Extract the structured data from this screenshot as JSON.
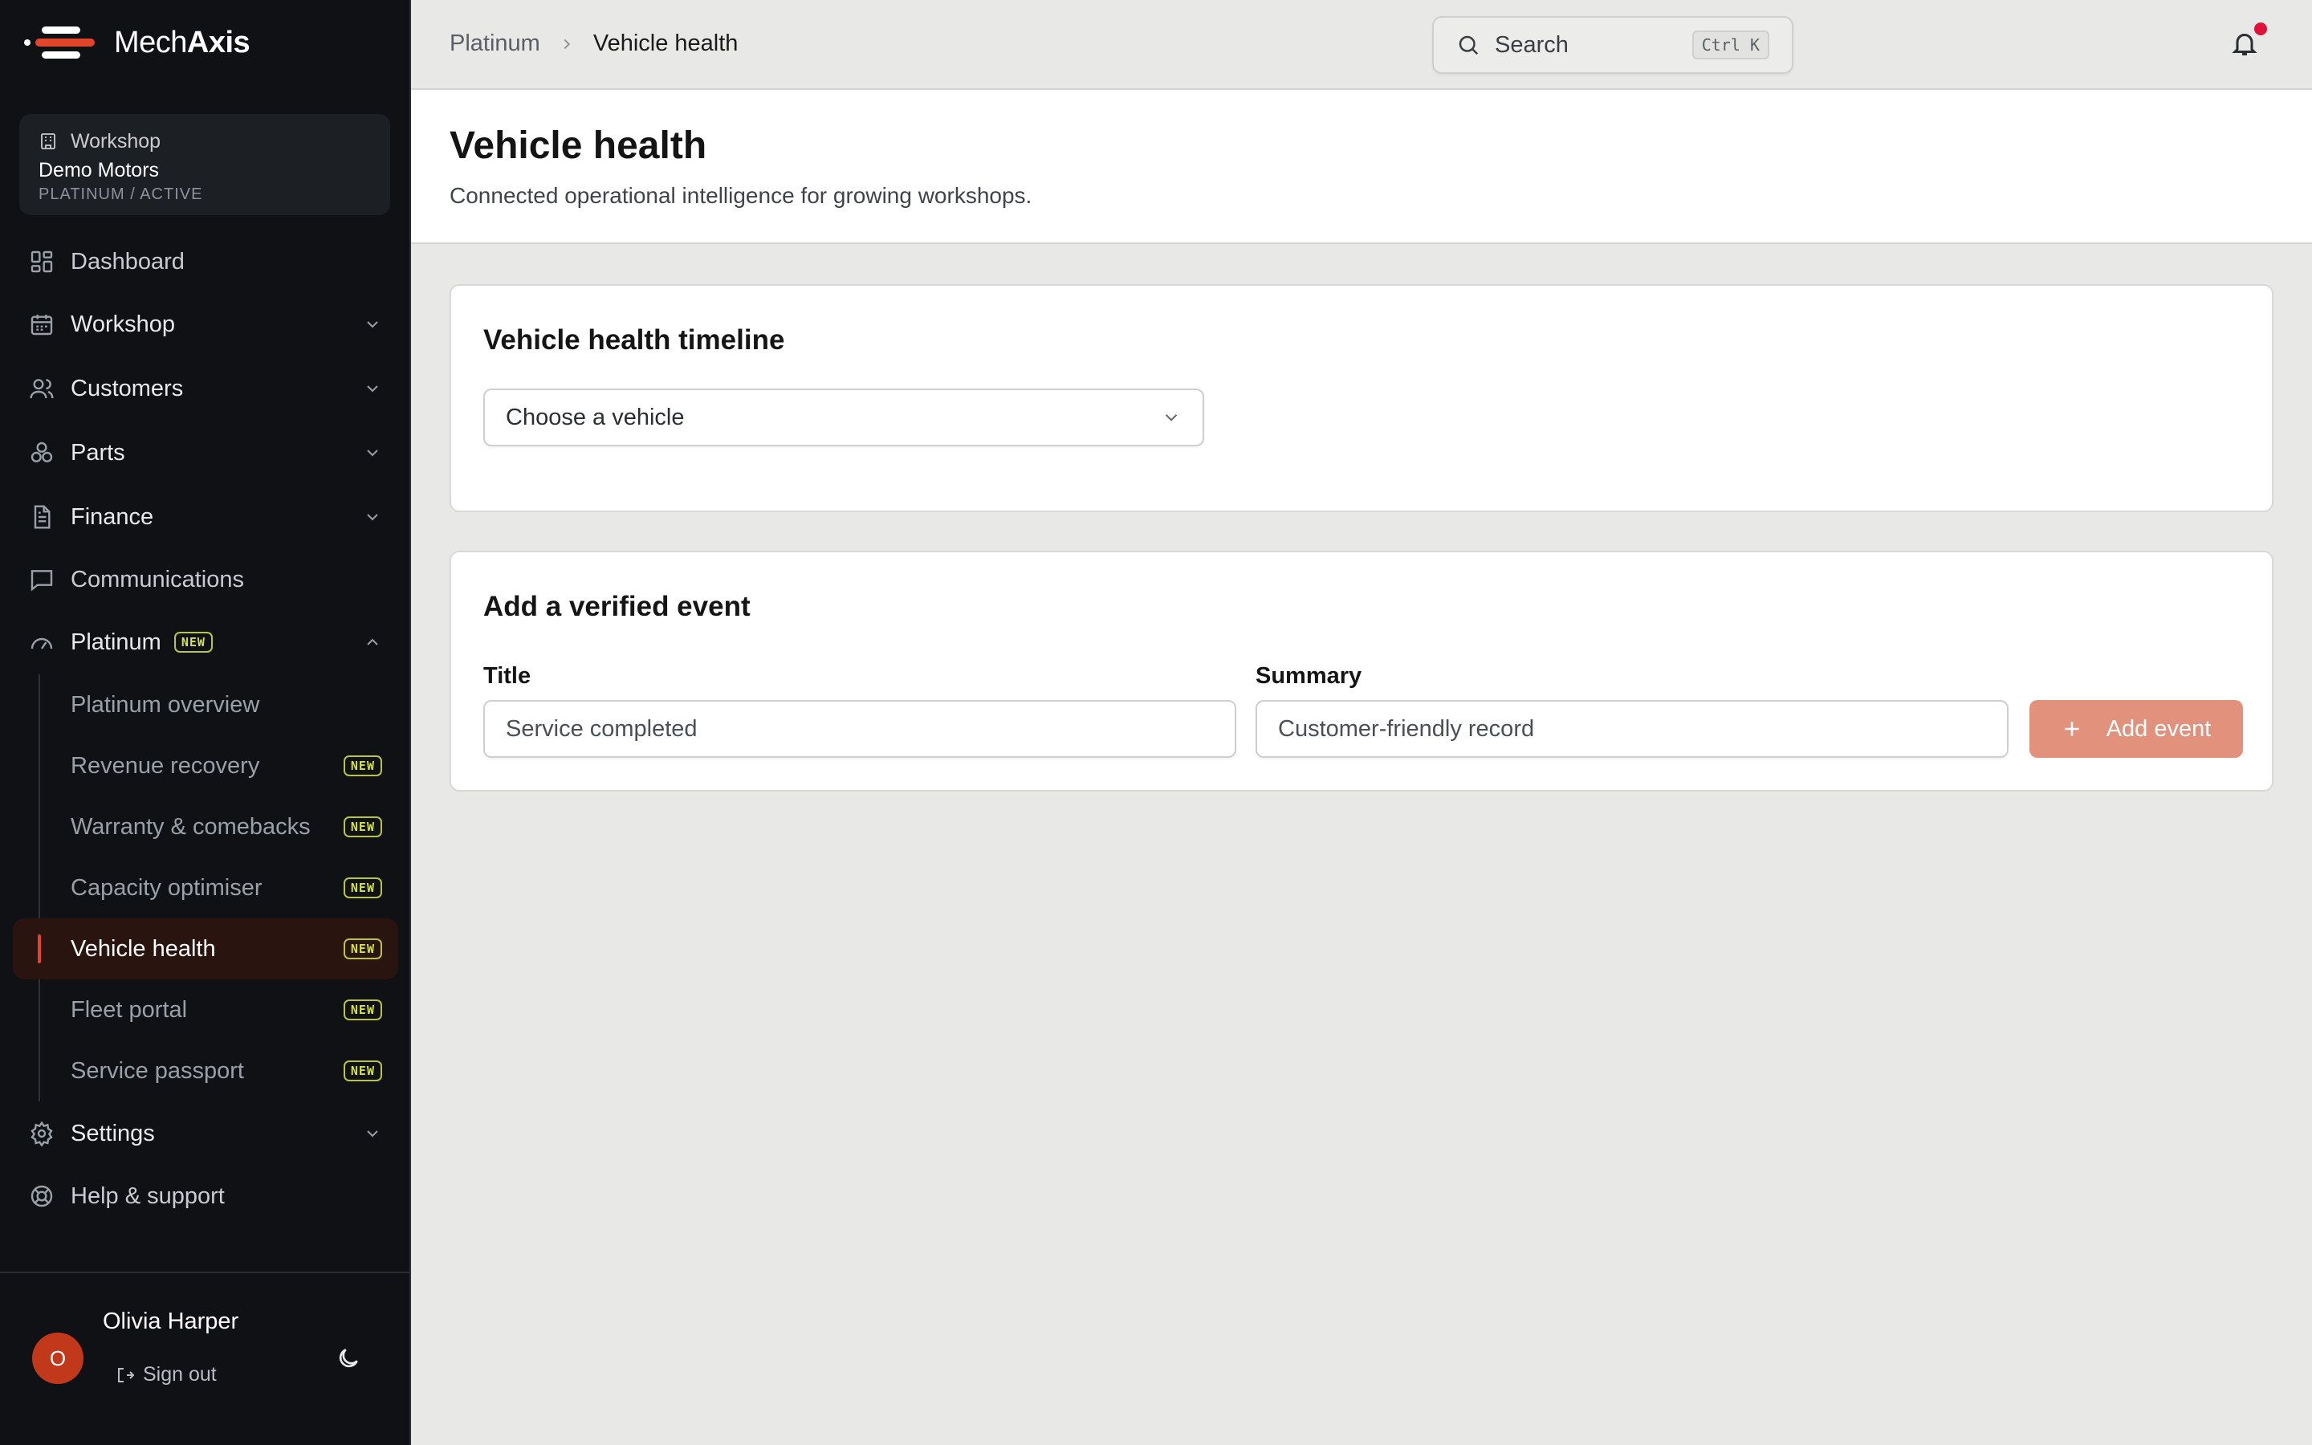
{
  "brand": {
    "name_light": "Mech",
    "name_bold": "Axis"
  },
  "workspace": {
    "label": "Workshop",
    "name": "Demo Motors",
    "plan": "PLATINUM / ACTIVE"
  },
  "nav": {
    "dashboard": "Dashboard",
    "workshop": "Workshop",
    "customers": "Customers",
    "parts": "Parts",
    "finance": "Finance",
    "communications": "Communications",
    "platinum": "Platinum",
    "platinum_badge": "NEW",
    "sub": [
      {
        "label": "Platinum overview",
        "badge": ""
      },
      {
        "label": "Revenue recovery",
        "badge": "NEW"
      },
      {
        "label": "Warranty & comebacks",
        "badge": "NEW"
      },
      {
        "label": "Capacity optimiser",
        "badge": "NEW"
      },
      {
        "label": "Vehicle health",
        "badge": "NEW"
      },
      {
        "label": "Fleet portal",
        "badge": "NEW"
      },
      {
        "label": "Service passport",
        "badge": "NEW"
      }
    ],
    "settings": "Settings",
    "help": "Help & support"
  },
  "user": {
    "initial": "O",
    "name": "Olivia Harper",
    "sign_out": "Sign out"
  },
  "breadcrumb": {
    "parent": "Platinum",
    "current": "Vehicle health"
  },
  "search": {
    "placeholder": "Search",
    "shortcut": "Ctrl K"
  },
  "page": {
    "title": "Vehicle health",
    "subtitle": "Connected operational intelligence for growing workshops."
  },
  "timeline": {
    "title": "Vehicle health timeline",
    "select_value": "Choose a vehicle"
  },
  "event_form": {
    "title": "Add a verified event",
    "title_label": "Title",
    "title_placeholder": "Service completed",
    "summary_label": "Summary",
    "summary_placeholder": "Customer-friendly record",
    "add_button": "Add event"
  },
  "colors": {
    "sidebar_bg": "#0f1115",
    "accent": "#e2452a",
    "add_button_bg": "#e2917c",
    "badge": "#d6e04a",
    "notification_dot": "#e0123a"
  }
}
